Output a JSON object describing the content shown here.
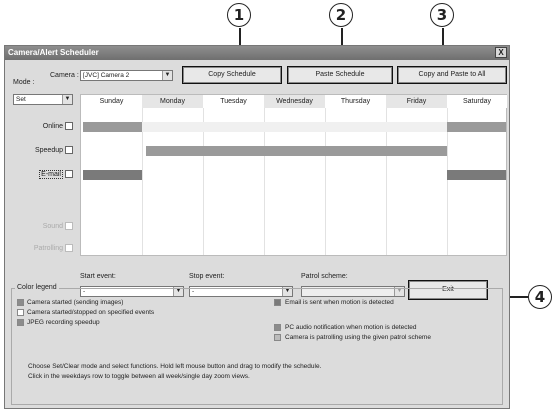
{
  "callouts": [
    "1",
    "2",
    "3",
    "4"
  ],
  "window": {
    "title": "Camera/Alert Scheduler",
    "close_glyph": "X"
  },
  "mode": {
    "label": "Mode :",
    "value": "Set"
  },
  "camera": {
    "label": "Camera :",
    "value": "[JVC] Camera 2"
  },
  "buttons": {
    "copy": "Copy Schedule",
    "paste": "Paste Schedule",
    "copy_all": "Copy and Paste to All",
    "exit": "Exit"
  },
  "days": [
    "Sunday",
    "Monday",
    "Tuesday",
    "Wednesday",
    "Thursday",
    "Friday",
    "Saturday"
  ],
  "rows": [
    {
      "label": "Online",
      "enabled": true
    },
    {
      "label": "Speedup",
      "enabled": true
    },
    {
      "label": "E-mail",
      "enabled": true
    },
    {
      "label": "Sound",
      "enabled": false
    },
    {
      "label": "Patrolling",
      "enabled": false
    }
  ],
  "events": {
    "start_label": "Start event:",
    "start_value": "-",
    "stop_label": "Stop event:",
    "stop_value": "-",
    "patrol_label": "Patrol scheme:",
    "patrol_value": ""
  },
  "legend": {
    "title": "Color legend",
    "items": [
      {
        "text": "Camera started (sending images)",
        "color": "#8c8c8c"
      },
      {
        "text": "Camera started/stopped on specified events",
        "color": "#ffffff"
      },
      {
        "text": "JPEG recording speedup",
        "color": "#8c8c8c"
      },
      {
        "text": "Email is sent when motion is detected",
        "color": "#7a7a7a"
      },
      {
        "text": "PC audio notification when motion is detected",
        "color": "#8c8c8c"
      },
      {
        "text": "Camera is patrolling using the given patrol scheme",
        "color": "#bcbcbc"
      }
    ],
    "help1": "Choose Set/Clear mode and select functions. Hold left mouse button and drag to modify the schedule.",
    "help2": "Click in the weekdays row to toggle between all week/single day zoom views."
  }
}
